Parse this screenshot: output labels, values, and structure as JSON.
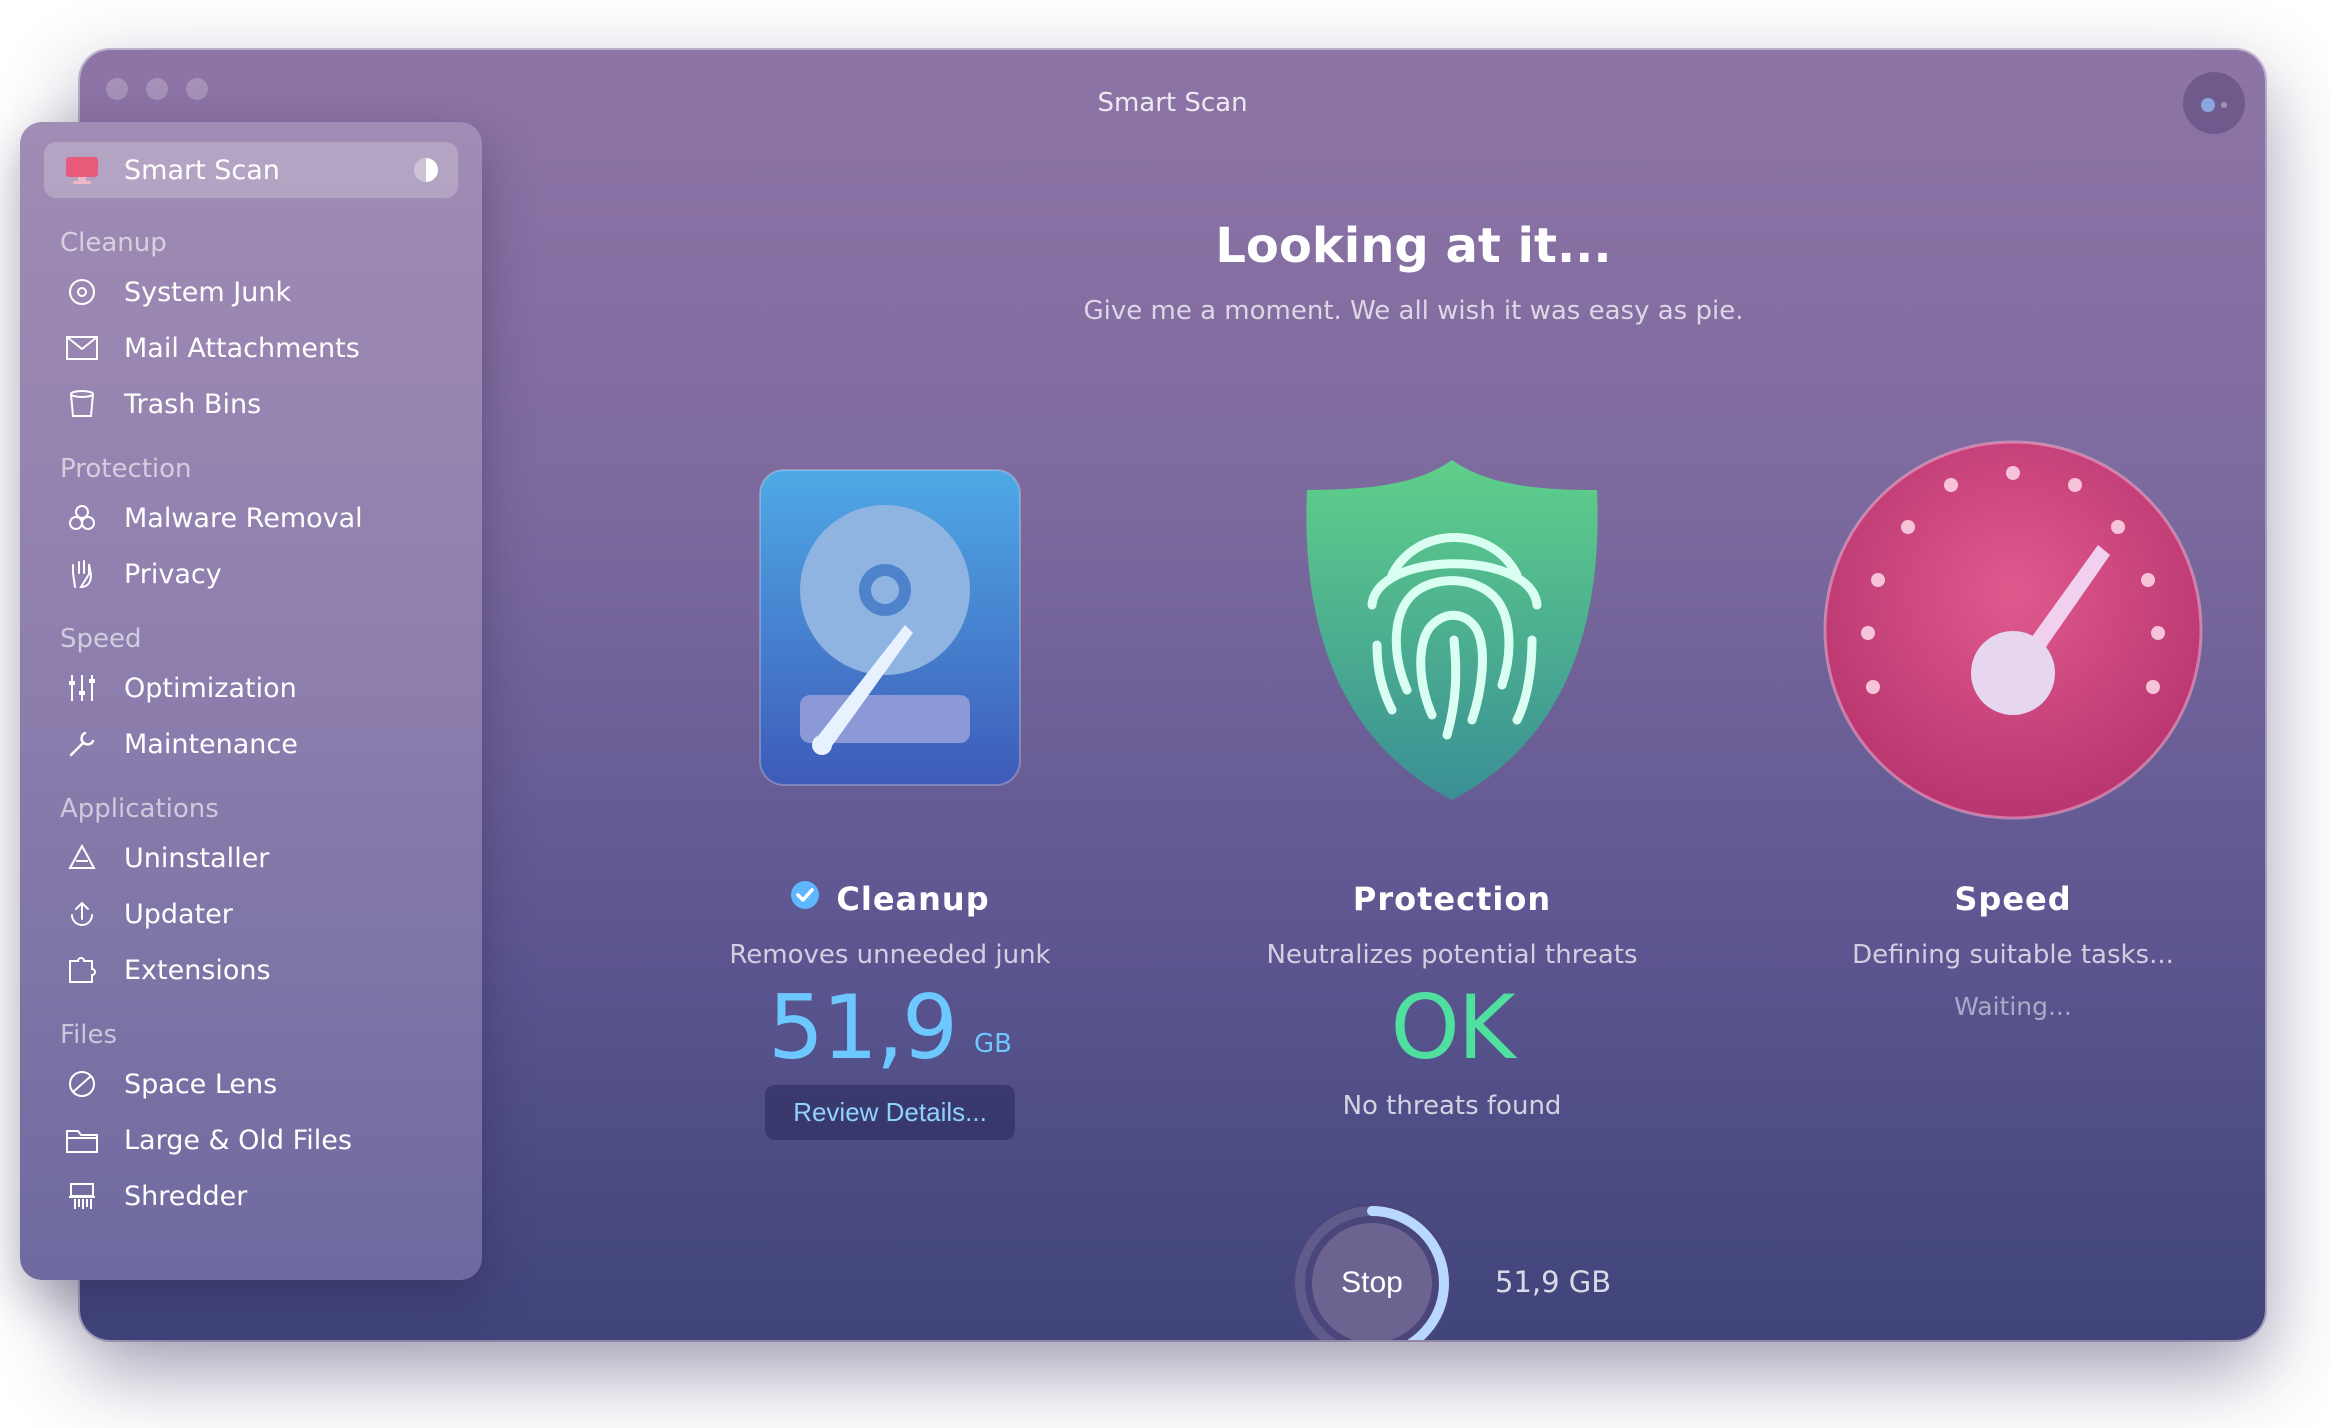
{
  "window": {
    "title": "Smart Scan"
  },
  "sidebar": {
    "active": {
      "label": "Smart Scan"
    },
    "sections": [
      {
        "heading": "Cleanup",
        "items": [
          "System Junk",
          "Mail Attachments",
          "Trash Bins"
        ]
      },
      {
        "heading": "Protection",
        "items": [
          "Malware Removal",
          "Privacy"
        ]
      },
      {
        "heading": "Speed",
        "items": [
          "Optimization",
          "Maintenance"
        ]
      },
      {
        "heading": "Applications",
        "items": [
          "Uninstaller",
          "Updater",
          "Extensions"
        ]
      },
      {
        "heading": "Files",
        "items": [
          "Space Lens",
          "Large & Old Files",
          "Shredder"
        ]
      }
    ]
  },
  "main": {
    "title": "Looking at it...",
    "subtitle": "Give me a moment. We all wish it was easy as pie.",
    "cleanup": {
      "name": "Cleanup",
      "desc": "Removes unneeded junk",
      "value": "51,9",
      "unit": "GB",
      "review_label": "Review Details..."
    },
    "protection": {
      "name": "Protection",
      "desc": "Neutralizes potential threats",
      "status": "OK",
      "foot": "No threats found"
    },
    "speed": {
      "name": "Speed",
      "desc": "Defining suitable tasks...",
      "waiting": "Waiting..."
    }
  },
  "scan": {
    "stop_label": "Stop",
    "size": "51,9 GB",
    "progress": 0.45
  },
  "colors": {
    "cleanup_value": "#6cc8ff",
    "protection_ok": "#4fe0a0",
    "accent_ring": "#b9d8ff"
  }
}
